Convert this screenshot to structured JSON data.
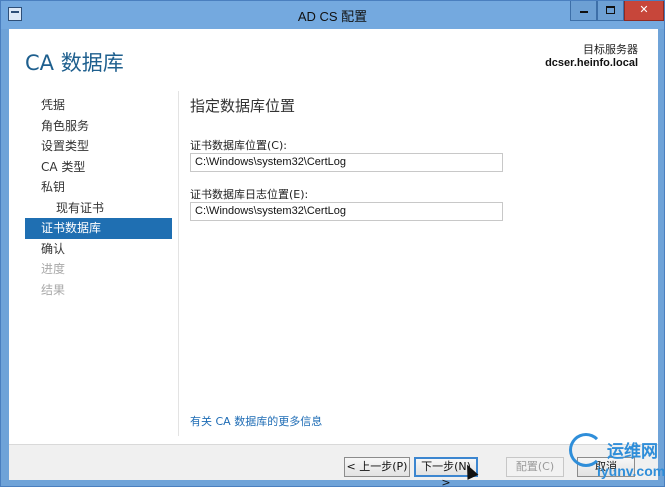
{
  "window": {
    "title": "AD CS 配置",
    "close_glyph": "✕"
  },
  "header": {
    "page_title": "CA 数据库",
    "target_label": "目标服务器",
    "target_value": "dcser.heinfo.local"
  },
  "nav": {
    "items": [
      {
        "label": "凭据",
        "state": "normal"
      },
      {
        "label": "角色服务",
        "state": "normal"
      },
      {
        "label": "设置类型",
        "state": "normal"
      },
      {
        "label": "CA 类型",
        "state": "normal"
      },
      {
        "label": "私钥",
        "state": "normal"
      },
      {
        "label": "现有证书",
        "state": "sub"
      },
      {
        "label": "证书数据库",
        "state": "selected"
      },
      {
        "label": "确认",
        "state": "normal"
      },
      {
        "label": "进度",
        "state": "disabled"
      },
      {
        "label": "结果",
        "state": "disabled"
      }
    ]
  },
  "main": {
    "section_title": "指定数据库位置",
    "db_label": "证书数据库位置(C):",
    "db_value": "C:\\Windows\\system32\\CertLog",
    "log_label": "证书数据库日志位置(E):",
    "log_value": "C:\\Windows\\system32\\CertLog",
    "more_link": "有关 CA 数据库的更多信息"
  },
  "footer": {
    "prev_label": "< 上一步(P)",
    "next_label": "下一步(N) >",
    "configure_label": "配置(C)",
    "cancel_label": "取消"
  },
  "watermark": {
    "title": "运维网",
    "url": "iyunv.com"
  },
  "colors": {
    "accent": "#1f6fb2",
    "title_blue": "#1e5f8e",
    "link": "#1e6cb5",
    "titlebar": "#74a9df",
    "close": "#c7463a"
  },
  "icons": [
    "app-icon",
    "minimize-icon",
    "maximize-icon",
    "close-icon",
    "cursor-icon",
    "watermark-logo-icon"
  ]
}
